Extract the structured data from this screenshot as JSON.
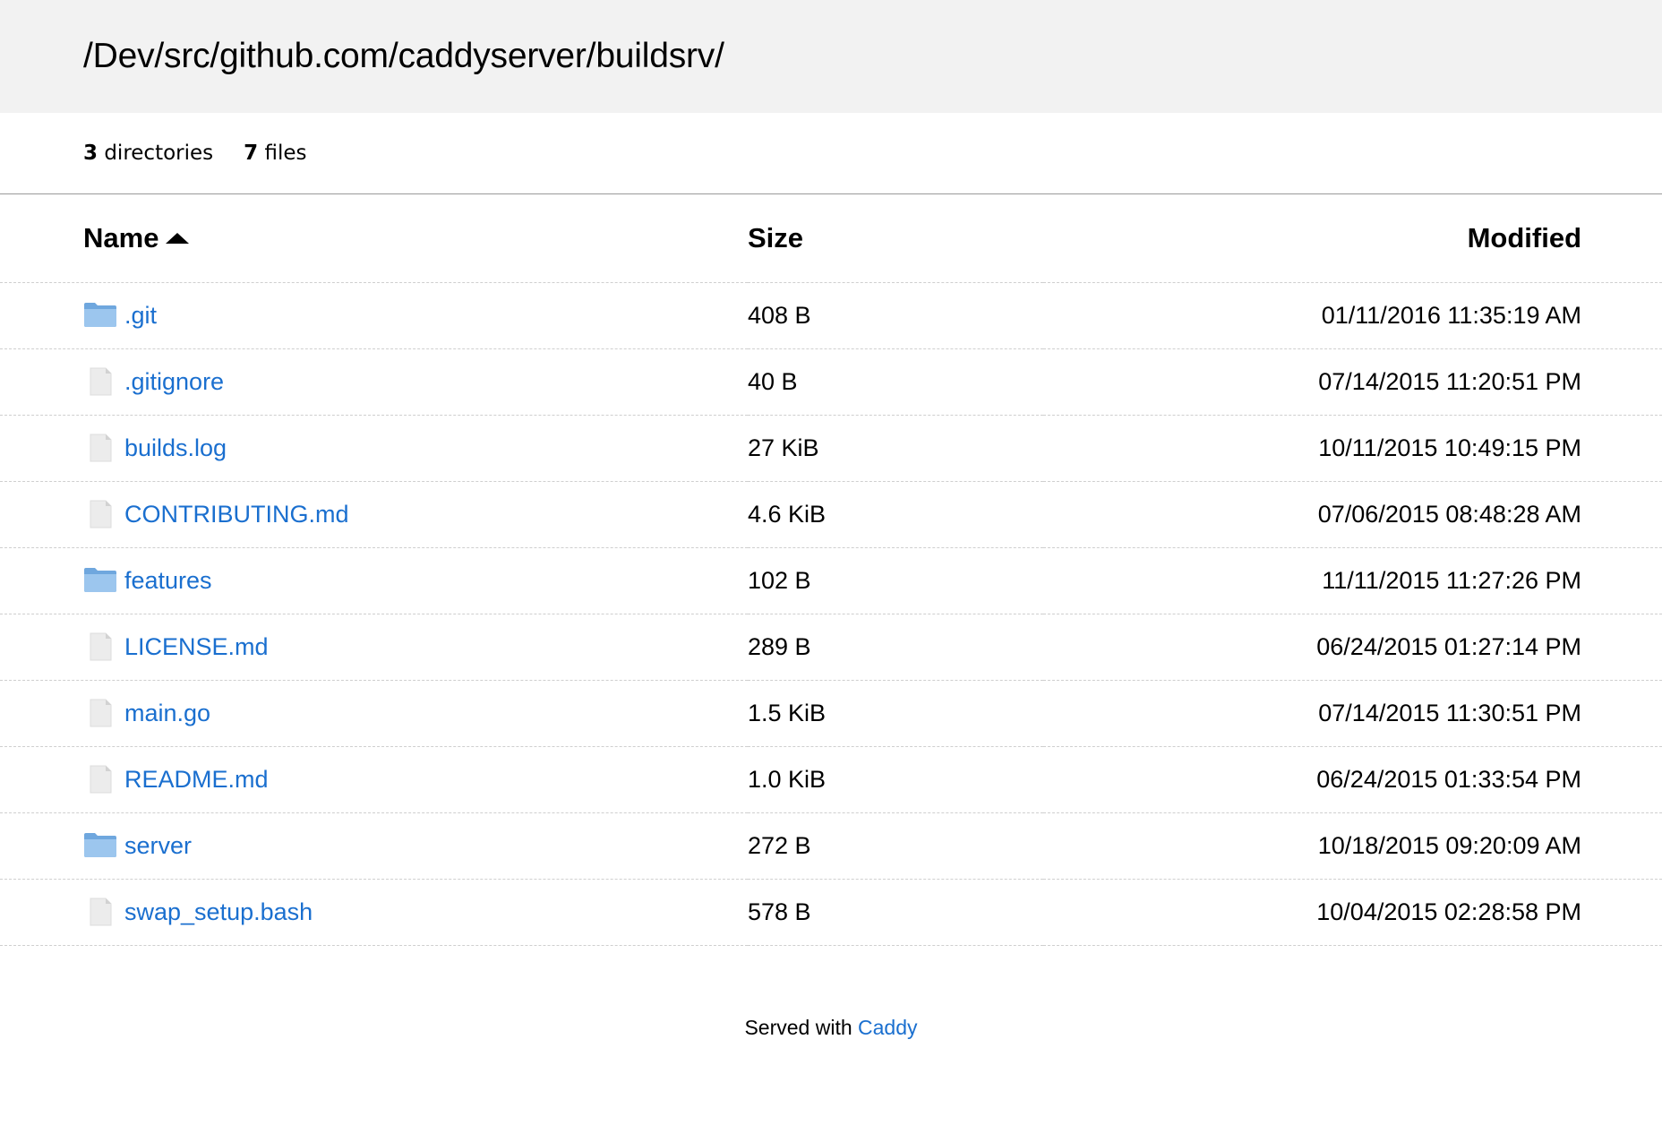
{
  "header": {
    "path": "/Dev/src/github.com/caddyserver/buildsrv/"
  },
  "summary": {
    "dir_count": "3",
    "dir_label": "directories",
    "file_count": "7",
    "file_label": "files"
  },
  "table": {
    "columns": {
      "name": "Name",
      "size": "Size",
      "modified": "Modified"
    },
    "sort": {
      "column": "name",
      "direction": "ascending"
    },
    "rows": [
      {
        "name": ".git",
        "type": "folder",
        "icon": "folder-icon",
        "size": "408 B",
        "modified": "01/11/2016 11:35:19 AM"
      },
      {
        "name": ".gitignore",
        "type": "file",
        "icon": "file-icon",
        "size": "40 B",
        "modified": "07/14/2015 11:20:51 PM"
      },
      {
        "name": "builds.log",
        "type": "file",
        "icon": "file-icon",
        "size": "27 KiB",
        "modified": "10/11/2015 10:49:15 PM"
      },
      {
        "name": "CONTRIBUTING.md",
        "type": "file",
        "icon": "file-icon",
        "size": "4.6 KiB",
        "modified": "07/06/2015 08:48:28 AM"
      },
      {
        "name": "features",
        "type": "folder",
        "icon": "folder-icon",
        "size": "102 B",
        "modified": "11/11/2015 11:27:26 PM"
      },
      {
        "name": "LICENSE.md",
        "type": "file",
        "icon": "file-icon",
        "size": "289 B",
        "modified": "06/24/2015 01:27:14 PM"
      },
      {
        "name": "main.go",
        "type": "file",
        "icon": "file-icon",
        "size": "1.5 KiB",
        "modified": "07/14/2015 11:30:51 PM"
      },
      {
        "name": "README.md",
        "type": "file",
        "icon": "file-icon",
        "size": "1.0 KiB",
        "modified": "06/24/2015 01:33:54 PM"
      },
      {
        "name": "server",
        "type": "folder",
        "icon": "folder-icon",
        "size": "272 B",
        "modified": "10/18/2015 09:20:09 AM"
      },
      {
        "name": "swap_setup.bash",
        "type": "file",
        "icon": "file-icon",
        "size": "578 B",
        "modified": "10/04/2015 02:28:58 PM"
      }
    ]
  },
  "footer": {
    "prefix": "Served with",
    "link": "Caddy"
  },
  "colors": {
    "link": "#1a6fcf",
    "header_bg": "#f2f2f2",
    "folder": "#8fbbe6"
  }
}
